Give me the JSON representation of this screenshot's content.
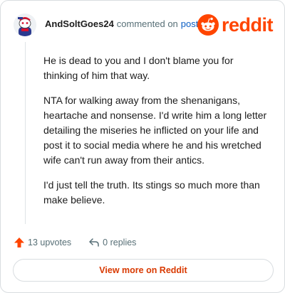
{
  "comment": {
    "username": "AndSoltGoes24",
    "commented_on_text": "commented on",
    "post_link_label": "post",
    "brand_wordmark": "reddit",
    "paragraphs": [
      "He is dead to you and I don't blame you for thinking of him that way.",
      "NTA for walking away from the shenanigans, heartache and nonsense. I'd write him a long letter detailing the miseries he inflicted on your life and post it to social media where he and his wretched wife can't run away from their antics.",
      "I'd just tell the truth. Its stings so much more than make believe."
    ],
    "upvotes_label": "13 upvotes",
    "replies_label": "0 replies",
    "view_more_label": "View more on Reddit"
  },
  "colors": {
    "brand_orange": "#ff4500",
    "upvote_arrow": "#ff4500",
    "link_blue": "#0b5ec4",
    "view_more_text": "#d93900"
  },
  "icons": {
    "avatar": "snoo-avatar-icon",
    "logo": "reddit-snoo-icon",
    "upvote": "upvote-arrow-icon",
    "reply": "reply-arrow-icon"
  }
}
